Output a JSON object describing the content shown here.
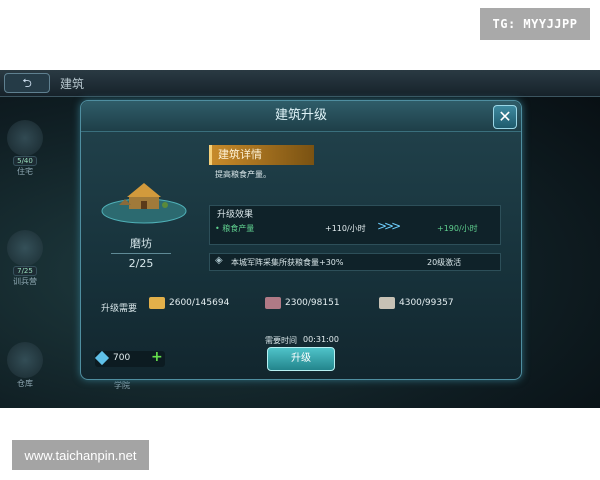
{
  "watermark_top": "TG: MYYJJPP",
  "watermark_bottom": "www.taichanpin.net",
  "topbar": {
    "back": "⮌",
    "title": "建筑"
  },
  "sidebar": [
    {
      "tag": "5/40",
      "label": "住宅"
    },
    {
      "tag": "7/25",
      "label": "训兵营"
    },
    {
      "label": "仓库"
    }
  ],
  "dialog": {
    "title": "建筑升级",
    "close": "✕",
    "building": {
      "name": "磨坊",
      "count": "2/25"
    },
    "details_header": "建筑详情",
    "description": "提高粮食产量。",
    "effect": {
      "label": "升级效果",
      "stat_name": "• 粮食产量",
      "current": "+110/小时",
      "arrow": ">>>",
      "next": "+190/小时"
    },
    "bonus": {
      "icon": "◈",
      "text": "本城军阵采集所获粮食量+30%",
      "level": "20级激活"
    },
    "requirements": {
      "label": "升级需要",
      "items": [
        {
          "value": "2600/145694",
          "color": "#e2b04a"
        },
        {
          "value": "2300/98151",
          "color": "#b07a86"
        },
        {
          "value": "4300/99357",
          "color": "#c7c2b5"
        }
      ]
    },
    "time": {
      "label": "需要时间",
      "value": "00:31:00"
    },
    "upgrade_button": "升级",
    "gems": {
      "count": "700",
      "plus": "+"
    }
  },
  "bottom_label": "学院"
}
